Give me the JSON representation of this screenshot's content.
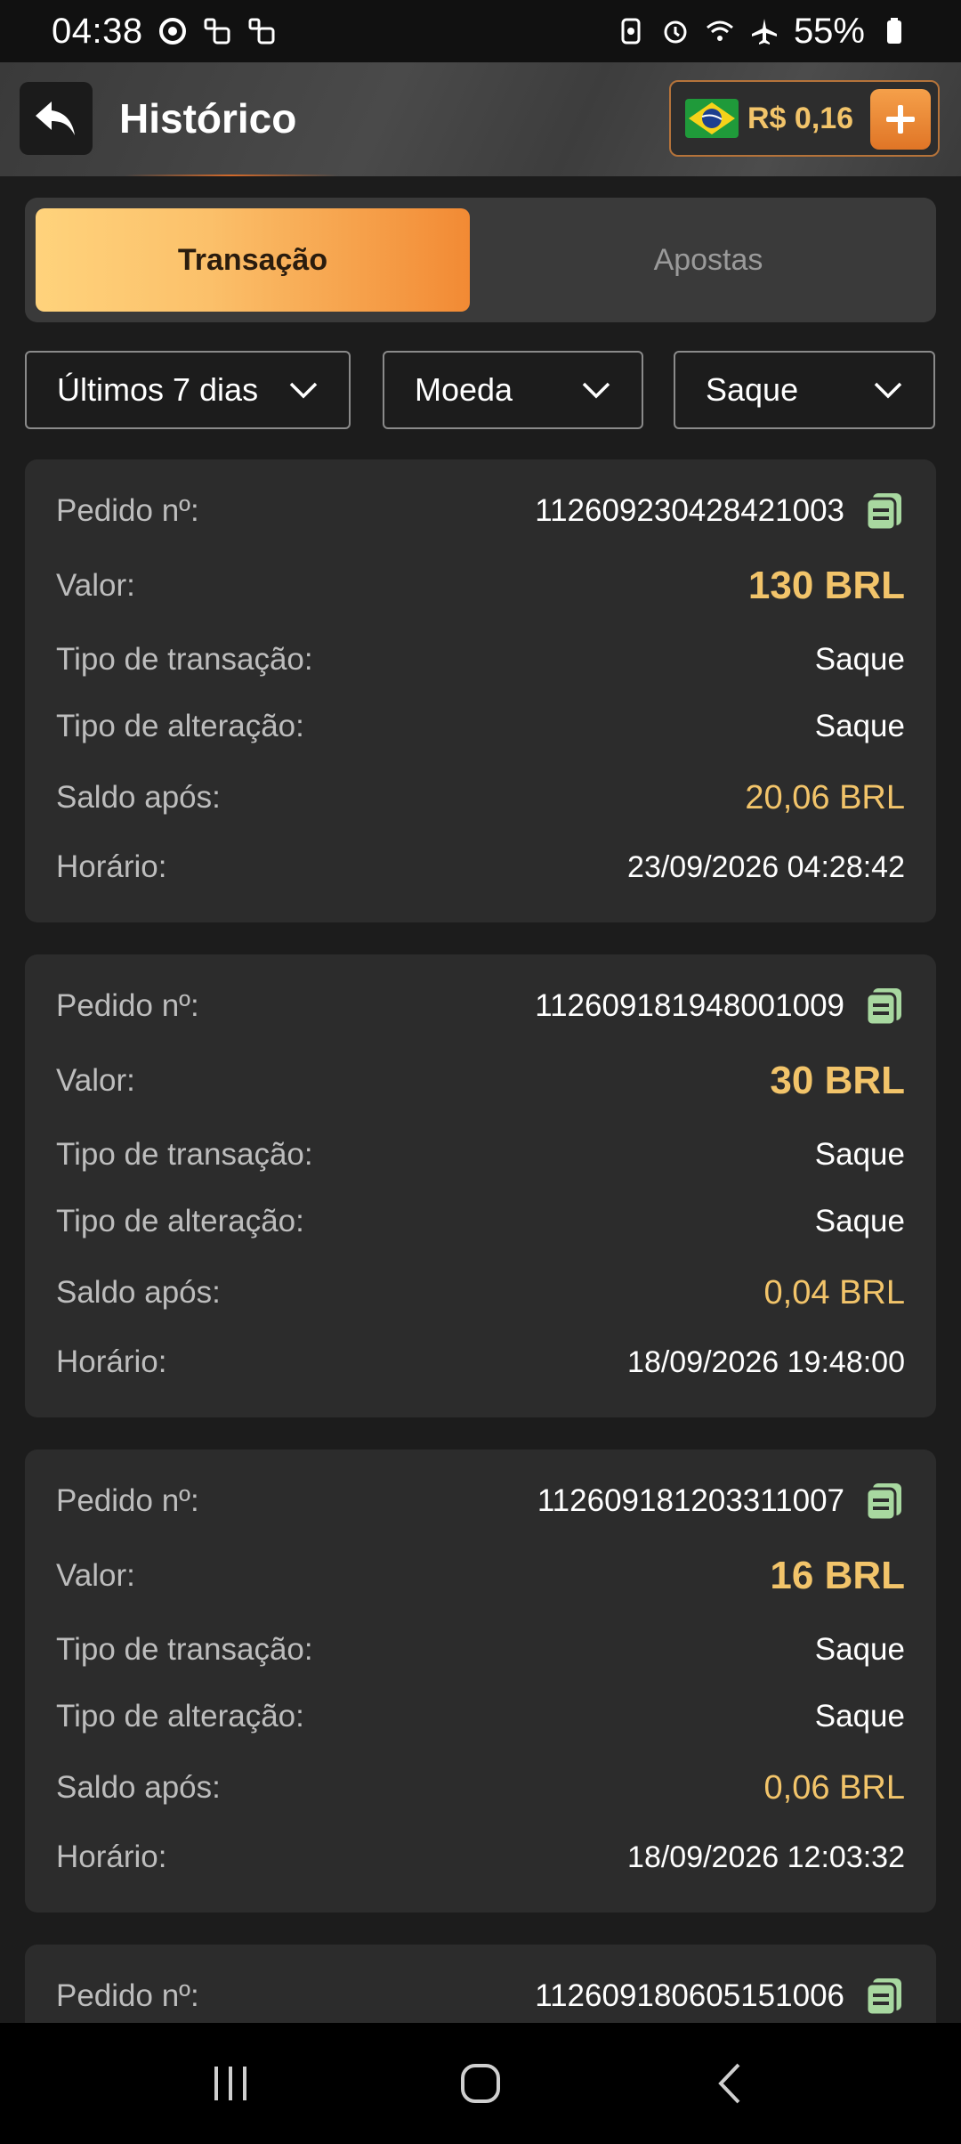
{
  "status_bar": {
    "time": "04:38",
    "battery_percent": "55%"
  },
  "header": {
    "title": "Histórico",
    "balance": "R$ 0,16"
  },
  "tabs": [
    {
      "label": "Transação",
      "active": true
    },
    {
      "label": "Apostas",
      "active": false
    }
  ],
  "filters": {
    "period": "Últimos 7 dias",
    "currency": "Moeda",
    "type": "Saque"
  },
  "labels": {
    "order": "Pedido nº:",
    "amount": "Valor:",
    "transaction_type": "Tipo de transação:",
    "change_type": "Tipo de alteração:",
    "balance_after": "Saldo após:",
    "time": "Horário:"
  },
  "transactions": [
    {
      "order": "112609230428421003",
      "amount": "130 BRL",
      "transaction_type": "Saque",
      "change_type": "Saque",
      "balance_after": "20,06 BRL",
      "time": "23/09/2026 04:28:42"
    },
    {
      "order": "112609181948001009",
      "amount": "30 BRL",
      "transaction_type": "Saque",
      "change_type": "Saque",
      "balance_after": "0,04 BRL",
      "time": "18/09/2026 19:48:00"
    },
    {
      "order": "112609181203311007",
      "amount": "16 BRL",
      "transaction_type": "Saque",
      "change_type": "Saque",
      "balance_after": "0,06 BRL",
      "time": "18/09/2026 12:03:32"
    },
    {
      "order": "112609180605151006"
    }
  ],
  "colors": {
    "accent_gold": "#f2c46a",
    "accent_orange": "#f28a34",
    "card_bg": "#2c2c2c",
    "page_bg": "#1c1c1c",
    "copy_icon": "#a8d8a0"
  }
}
